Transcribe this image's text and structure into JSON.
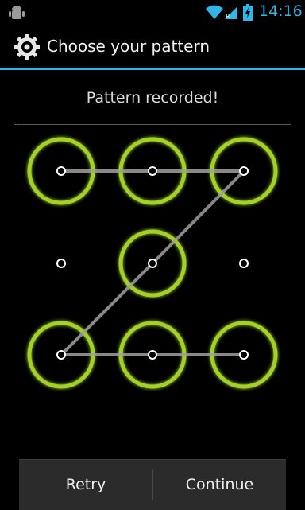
{
  "status_bar": {
    "time": "14:16",
    "icons": [
      "android-debug-icon",
      "wifi-icon",
      "signal-icon",
      "battery-charging-icon"
    ],
    "accent_color": "#33b5e5"
  },
  "action_bar": {
    "title": "Choose your pattern",
    "icon": "gear-icon"
  },
  "header": {
    "text": "Pattern recorded!"
  },
  "pattern": {
    "grid_size": 3,
    "dots": [
      1,
      2,
      3,
      4,
      5,
      6,
      7,
      8,
      9
    ],
    "selected_sequence": [
      1,
      2,
      3,
      5,
      7,
      8,
      9
    ],
    "ring_color": "#a3d12a",
    "line_color": "#a0a0a0"
  },
  "buttons": {
    "retry_label": "Retry",
    "continue_label": "Continue"
  }
}
